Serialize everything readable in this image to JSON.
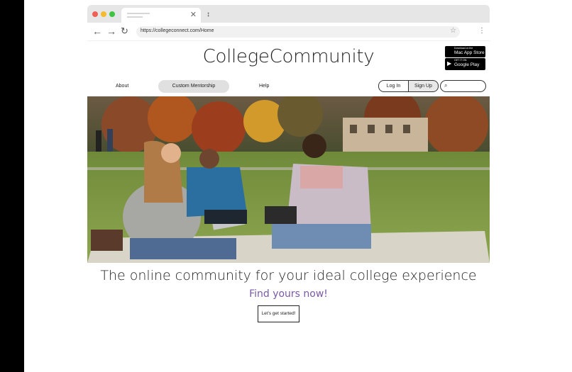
{
  "browser": {
    "url": "https://collegeconnect.com/Home",
    "tab_close": "✕",
    "new_tab": "↕",
    "back_icon": "arrow-left-icon",
    "forward_icon": "arrow-right-icon",
    "reload_icon": "reload-icon",
    "star_icon": "star-icon",
    "menu_icon": "kebab-menu-icon"
  },
  "site": {
    "brand": "CollegeCommunity",
    "app_store": {
      "small": "Download on the",
      "big": "Mac App Store"
    },
    "google_play": {
      "small": "GET IT ON",
      "big": "Google Play"
    }
  },
  "nav": {
    "about": "About",
    "mentorship": "Custom Mentorship",
    "help": "Help",
    "login": "Log In",
    "signup": "Sign Up",
    "search_icon": "search-icon"
  },
  "hero": {
    "tagline": "The online community for your ideal college experience",
    "cta_text": "Find yours now!",
    "cta_button": "Let's get started!"
  },
  "colors": {
    "accent": "#7b59a8",
    "pill": "#e0e0e0"
  }
}
